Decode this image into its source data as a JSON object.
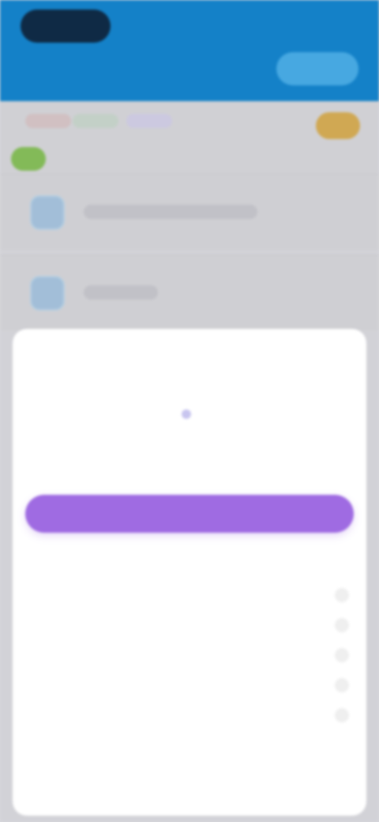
{
  "header": {
    "brand": "",
    "meta": "",
    "subtitle": "",
    "action": ""
  },
  "filters": {
    "chip1": "",
    "chip2": "",
    "chip3": ""
  },
  "background_list": {
    "row1_label": "",
    "row2_label": ""
  },
  "modal": {
    "title": "",
    "price": "",
    "description": "",
    "primary_button": "",
    "helper_text": "",
    "options": [
      {
        "label": ""
      },
      {
        "label": ""
      },
      {
        "label": ""
      },
      {
        "label": ""
      },
      {
        "label": ""
      }
    ],
    "done_label": ""
  },
  "colors": {
    "header_blue": "#1586cf",
    "brand_dark": "#102c48",
    "accent_purple": "#9f6be2",
    "green_badge": "#88c15b",
    "gold_badge": "#d7ae56"
  }
}
